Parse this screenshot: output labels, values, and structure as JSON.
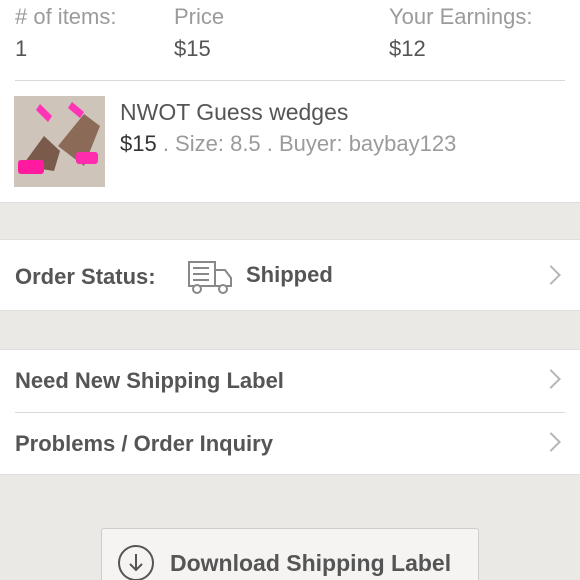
{
  "summary": {
    "items_label": "# of items:",
    "items_value": "1",
    "price_label": "Price",
    "price_value": "$15",
    "earnings_label": "Your Earnings:",
    "earnings_value": "$12"
  },
  "item": {
    "title": "NWOT Guess wedges",
    "price": "$15",
    "details": " . Size: 8.5 . Buyer: baybay123"
  },
  "status": {
    "label": "Order Status:",
    "value": "Shipped",
    "icon": "delivery-truck-icon"
  },
  "links": [
    {
      "label": "Need New Shipping Label"
    },
    {
      "label": "Problems / Order Inquiry"
    }
  ],
  "download": {
    "label": "Download Shipping Label",
    "icon": "download-circle-icon"
  },
  "colors": {
    "background": "#ebe9e5",
    "card": "#ffffff",
    "text_dark": "#555555",
    "text_muted": "#9b9b9b"
  }
}
